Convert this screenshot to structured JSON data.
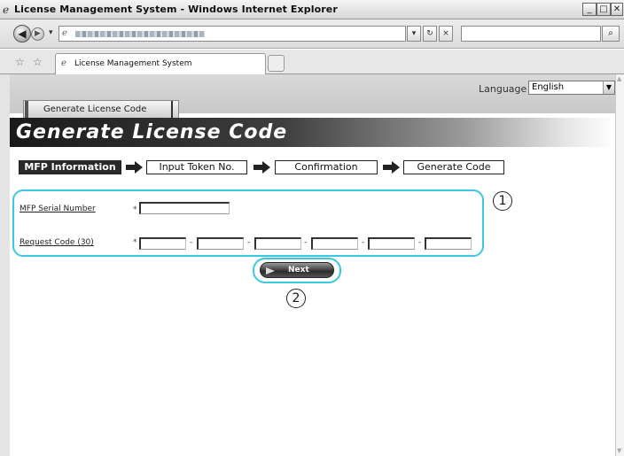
{
  "window": {
    "title": "License Management System - Windows Internet Explorer",
    "minimize_icon": "minimize-icon",
    "maximize_icon": "maximize-icon",
    "close_icon": "close-icon"
  },
  "browser": {
    "back_icon": "back-arrow-icon",
    "forward_icon": "forward-arrow-icon",
    "refresh_symbol": "↻",
    "stop_symbol": "×",
    "search_symbol": "⌕",
    "tab_label": "License Management System"
  },
  "language": {
    "label": "Language",
    "selected": "English"
  },
  "page": {
    "tab_label": "Generate License Code",
    "banner_title": "Generate License Code"
  },
  "steps": [
    {
      "label": "MFP Information",
      "active": true
    },
    {
      "label": "Input Token No.",
      "active": false
    },
    {
      "label": "Confirmation",
      "active": false
    },
    {
      "label": "Generate Code",
      "active": false
    }
  ],
  "form": {
    "serial_label": "MFP Serial Number",
    "request_label": "Request Code (30)",
    "required_mark": "*",
    "separator": "-",
    "serial_value": "",
    "request_values": [
      "",
      "",
      "",
      "",
      "",
      ""
    ]
  },
  "actions": {
    "next_label": "Next"
  },
  "callouts": {
    "one": "1",
    "two": "2"
  },
  "colors": {
    "callout_outline": "#3cc7e3",
    "banner_dark": "#1a1a1a"
  }
}
